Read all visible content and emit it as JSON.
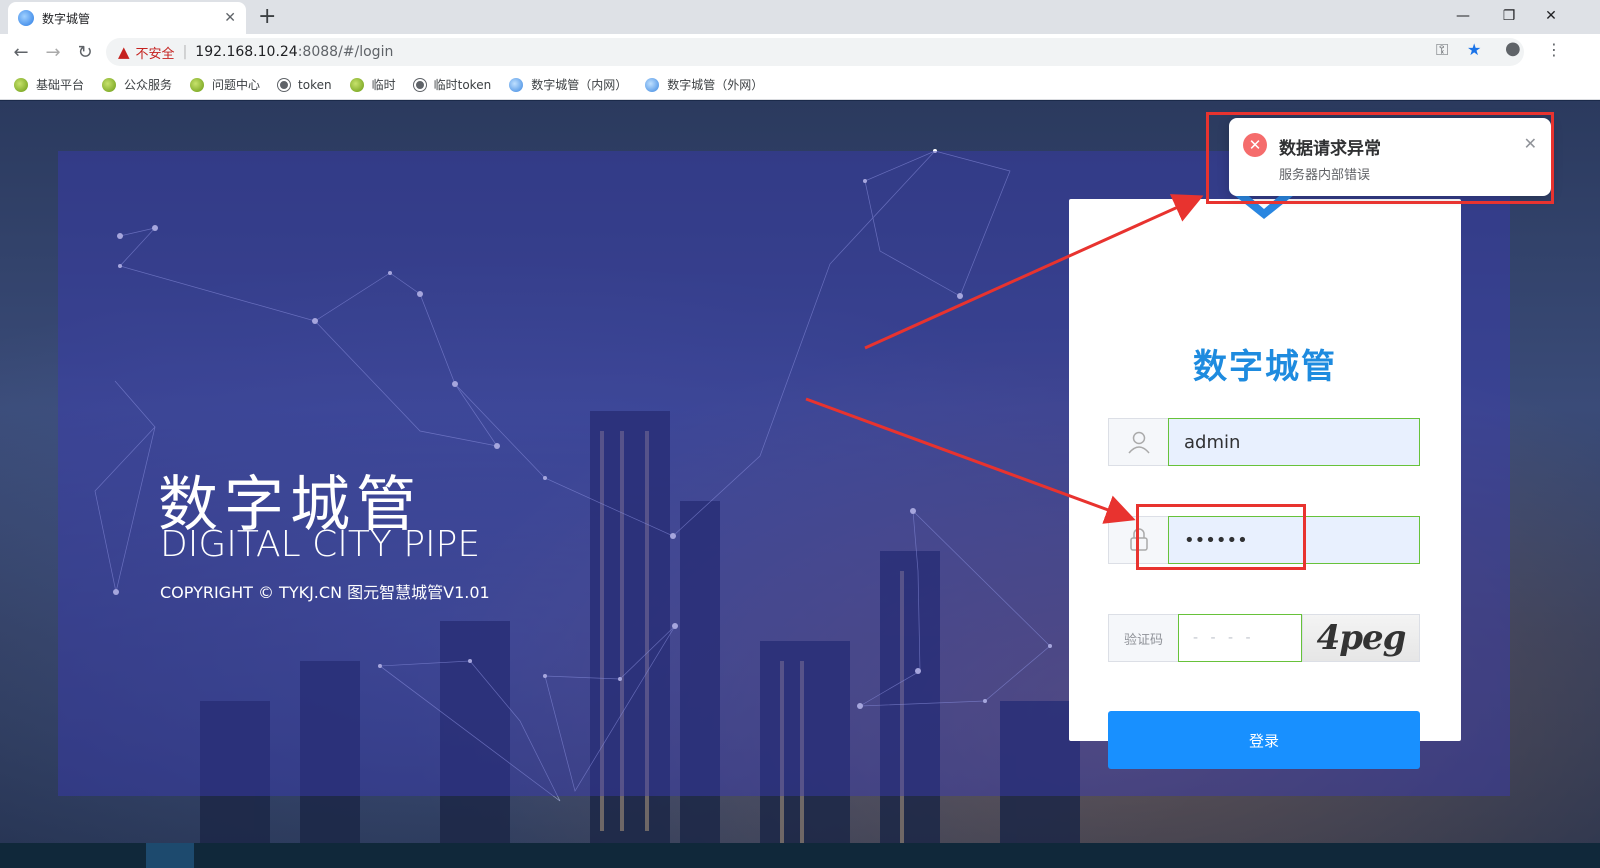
{
  "browser": {
    "tab_title": "数字城管",
    "new_tab": "+",
    "security_label": "不安全",
    "url_host": "192.168.10.24",
    "url_path": ":8088/#/login",
    "bookmarks": [
      "基础平台",
      "公众服务",
      "问题中心",
      "token",
      "临时",
      "临时token",
      "数字城管（内网）",
      "数字城管（外网）"
    ]
  },
  "hero": {
    "title_cn": "数字城管",
    "title_en": "DIGITAL CITY PIPE",
    "copyright": "COPYRIGHT © TYKJ.CN 图元智慧城管V1.01"
  },
  "login": {
    "title": "数字城管",
    "username": "admin",
    "password": "••••••",
    "captcha_label": "验证码",
    "captcha_placeholder": "- - - -",
    "captcha_text": "4peg",
    "submit_label": "登录"
  },
  "notification": {
    "title": "数据请求异常",
    "message": "服务器内部错误"
  },
  "colors": {
    "accent": "#1890ff",
    "brand_title": "#1e8bdf",
    "error": "#f56c6c",
    "annotation": "#e8332f"
  }
}
